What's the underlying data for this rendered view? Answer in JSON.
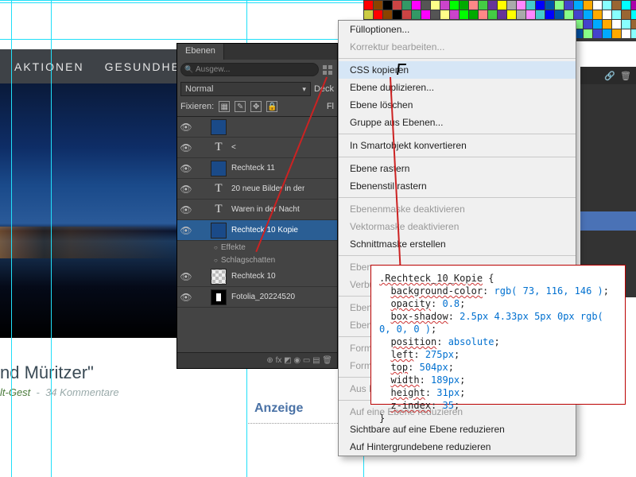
{
  "site": {
    "nav": [
      "AKTIONEN",
      "GESUNDHEIT"
    ],
    "headline": "nd Müritzer\"",
    "meta_author": "lt-Gest",
    "meta_comments": "34 Kommentare",
    "anzeige": "Anzeige"
  },
  "layers_panel": {
    "tab": "Ebenen",
    "search_placeholder": "Ausgew...",
    "blend_mode": "Normal",
    "deck_label": "Deck",
    "fix_label": "Fixieren:",
    "fill_label": "Fl",
    "layers": [
      {
        "eye": true,
        "kind": "rect",
        "label": ""
      },
      {
        "eye": true,
        "kind": "T",
        "label": "<"
      },
      {
        "eye": true,
        "kind": "rect",
        "label": "Rechteck 11"
      },
      {
        "eye": true,
        "kind": "T",
        "label": "20 neue Bilder in der"
      },
      {
        "eye": true,
        "kind": "T",
        "label": "Waren in der Nacht"
      },
      {
        "eye": true,
        "kind": "rect",
        "label": "Rechteck 10 Kopie",
        "selected": true,
        "effects": [
          "Effekte",
          "Schlagschatten"
        ]
      },
      {
        "eye": true,
        "kind": "cb",
        "label": "Rechteck 10"
      },
      {
        "eye": true,
        "kind": "fotolia",
        "label": "Fotolia_20224520"
      }
    ],
    "footer_glyphs": "⊕  fx  ◩  ◉  ▭  ▤  🗑"
  },
  "context_menu": [
    {
      "t": "Fülloptionen..."
    },
    {
      "t": "Korrektur bearbeiten...",
      "dis": true
    },
    {
      "sep": true
    },
    {
      "t": "CSS kopieren",
      "hl": true
    },
    {
      "t": "Ebene duplizieren..."
    },
    {
      "t": "Ebene löschen"
    },
    {
      "t": "Gruppe aus Ebenen..."
    },
    {
      "sep": true
    },
    {
      "t": "In Smartobjekt konvertieren"
    },
    {
      "sep": true
    },
    {
      "t": "Ebene rastern"
    },
    {
      "t": "Ebenenstil rastern"
    },
    {
      "sep": true
    },
    {
      "t": "Ebenenmaske deaktivieren",
      "dis": true
    },
    {
      "t": "Vektormaske deaktivieren",
      "dis": true
    },
    {
      "t": "Schnittmaske erstellen"
    },
    {
      "sep": true
    },
    {
      "t": "Ebene",
      "dis": true
    },
    {
      "t": "Verbu",
      "dis": true
    },
    {
      "sep": true
    },
    {
      "t": "Ebene",
      "dis": true
    },
    {
      "t": "Ebene",
      "dis": true
    },
    {
      "sep": true
    },
    {
      "t": "Forma",
      "dis": true
    },
    {
      "t": "Forma",
      "dis": true
    },
    {
      "sep": true
    },
    {
      "t": "Aus Is",
      "dis": true
    },
    {
      "sep": true
    },
    {
      "t": "Auf eine Ebene reduzieren",
      "dis": true
    },
    {
      "t": "Sichtbare auf eine Ebene reduzieren"
    },
    {
      "t": "Auf Hintergrundebene reduzieren"
    }
  ],
  "css_snippet": {
    "selector": ".Rechteck_10_Kopie",
    "props": [
      {
        "k": "background-color",
        "v": "rgb( 73, 116, 146 )"
      },
      {
        "k": "opacity",
        "v": "0.8"
      },
      {
        "k": "box-shadow",
        "v": "2.5px 4.33px 5px 0px rgb( 0, 0, 0 )"
      },
      {
        "k": "position",
        "v": "absolute"
      },
      {
        "k": "left",
        "v": "275px"
      },
      {
        "k": "top",
        "v": "504px"
      },
      {
        "k": "width",
        "v": "189px"
      },
      {
        "k": "height",
        "v": "31px"
      },
      {
        "k": "z-index",
        "v": "35"
      }
    ]
  },
  "chart_data": null
}
